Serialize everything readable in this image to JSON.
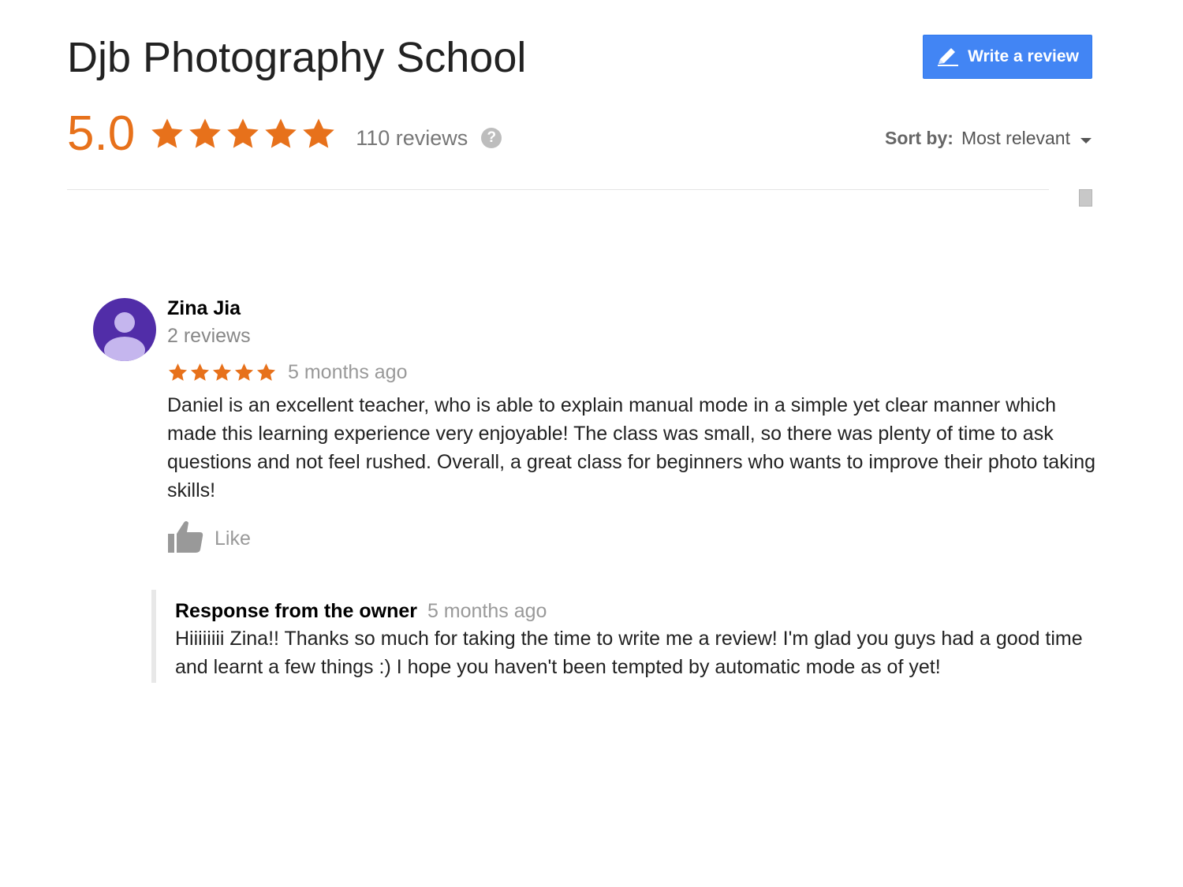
{
  "business": {
    "name": "Djb Photography School"
  },
  "header": {
    "write_review_label": "Write a review",
    "write_review_icon": "pencil-icon"
  },
  "rating": {
    "score": "5.0",
    "stars": 5,
    "count_label": "110 reviews",
    "help_icon": "?"
  },
  "sort": {
    "label": "Sort by:",
    "value": "Most relevant"
  },
  "review": {
    "author": "Zina Jia",
    "author_reviews": "2 reviews",
    "stars": 5,
    "date": "5 months ago",
    "text": "Daniel is an excellent teacher, who is able to explain manual mode in a simple yet clear manner which made this learning experience very enjoyable! The class was small, so there was plenty of time to ask questions and not feel rushed. Overall, a great class for beginners who wants to improve their photo taking skills!",
    "like_label": "Like",
    "owner_response": {
      "label": "Response from the owner",
      "date": "5 months ago",
      "text": "Hiiiiiiii Zina!! Thanks so much for taking the time to write me a review! I'm glad you guys had a good time and learnt a few things :) I hope you haven't been tempted by automatic mode as of yet!"
    }
  },
  "colors": {
    "accent_orange": "#e7711b",
    "button_blue": "#4285f4",
    "avatar_purple": "#512da8"
  }
}
